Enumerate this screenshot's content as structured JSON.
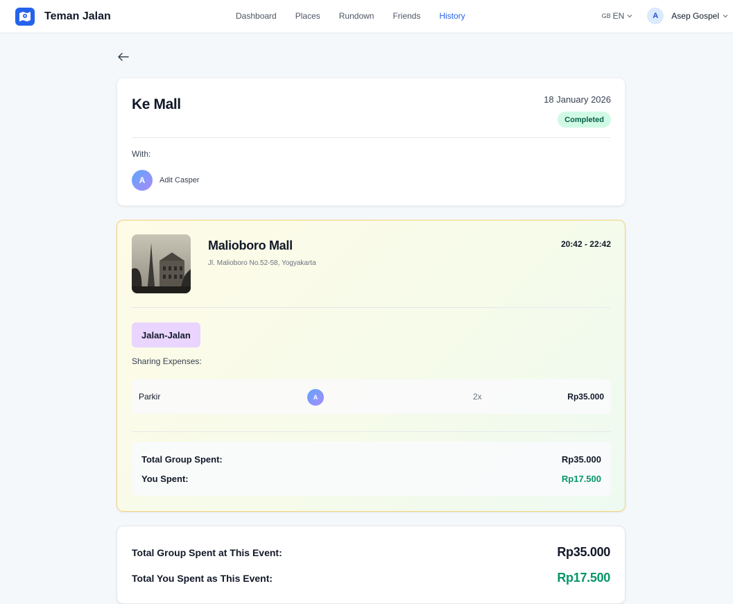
{
  "app": {
    "name": "Teman Jalan",
    "logo_icon": "map-pin-icon"
  },
  "nav": {
    "links": [
      {
        "label": "Dashboard",
        "active": false
      },
      {
        "label": "Places",
        "active": false
      },
      {
        "label": "Rundown",
        "active": false
      },
      {
        "label": "Friends",
        "active": false
      },
      {
        "label": "History",
        "active": true
      }
    ],
    "language": {
      "flag": "GB",
      "code": "EN"
    },
    "user": {
      "initial": "A",
      "name": "Asep Gospel"
    }
  },
  "event": {
    "title": "Ke Mall",
    "date": "18 January 2026",
    "status": "Completed",
    "with_label": "With:",
    "friends": [
      {
        "initial": "A",
        "name": "Adit Casper"
      }
    ]
  },
  "place": {
    "name": "Malioboro Mall",
    "address": "Jl. Malioboro No.52-58, Yogyakarta",
    "time": "20:42 - 22:42",
    "activity": "Jalan-Jalan",
    "sharing_label": "Sharing Expenses:",
    "expenses": [
      {
        "name": "Parkir",
        "avatar_initial": "A",
        "qty": "2x",
        "amount": "Rp35.000"
      }
    ],
    "summary": {
      "group_label": "Total Group Spent:",
      "group_value": "Rp35.000",
      "you_label": "You Spent:",
      "you_value": "Rp17.500"
    }
  },
  "totals": {
    "group_label": "Total Group Spent at This Event:",
    "group_value": "Rp35.000",
    "you_label": "Total You Spent as This Event:",
    "you_value": "Rp17.500"
  },
  "colors": {
    "accent": "#2563eb",
    "completed_bg": "#d1fae5",
    "activity_tag_bg": "#e9d5ff",
    "green": "#059669",
    "place_card_border": "#f3d37a"
  }
}
